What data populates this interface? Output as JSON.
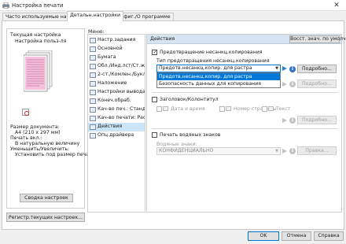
{
  "window": {
    "title": "Настройка печати",
    "close_glyph": "✕"
  },
  "tabs": [
    {
      "label": "Часто используемые настройки",
      "active": false
    },
    {
      "label": "Детальн.настройки",
      "active": true
    },
    {
      "label": "Конфиг./О программе",
      "active": false
    }
  ],
  "left_panel": {
    "heading": "Текущая настройка",
    "setting_name": "Настройка польз-ля",
    "doc_size_label": "Размер документа:",
    "doc_size_value": "A4 (210 x 297 мм)",
    "print_label": "Печать вкл.:",
    "print_value": "В натуральную величину",
    "reduce_label": "Уменьшить/Увеличить:",
    "reduce_value": "Установить под размер печат",
    "summary_button": "Сводка настроек",
    "register_button": "Регистр.текущих настроек..."
  },
  "menu": {
    "label": "Меню:",
    "selected_index": 11,
    "items": [
      "Настр.задания",
      "Основной",
      "Бумага",
      "Обл./Инд.лст/Ст.жрк",
      "2-ст./Комлен./Буклет",
      "Наложение",
      "Настройки вывода",
      "Конеч.обраб.",
      "Кач-во печ.: Станд.",
      "Кач-во печати: Расш.",
      "Действия",
      "Опц.драйвера"
    ]
  },
  "right_panel": {
    "header": "Действия",
    "reset_button": "Восст. знач. по умолч.",
    "copy_protect": {
      "label": "Предотвращение несанкц.копирования",
      "checked": true,
      "type_label": "Тип предотвращения несанкц.копирования",
      "selected": "Предотв.несанкц.копир. для растра",
      "options": [
        "Предотв.несанкц.копир. для растра",
        "Безопасность данных для копирования"
      ],
      "details_button": "Подробно...",
      "details_button_2": "Подробно..."
    },
    "header_footer": {
      "label": "Заголовок/Колонтитул",
      "checked": false,
      "date_time": "Дата и время",
      "page_number": "Номер страницы",
      "text": "Текст",
      "details_button": "Подробно..."
    },
    "watermark": {
      "label": "Печать водяных знаков",
      "checked": false,
      "sub_label": "Водяные знаки:",
      "value": "КОНФИДЕНЦИАЛЬНО",
      "edit_button": "Правка..."
    }
  },
  "footer": {
    "ok": "OK",
    "cancel": "Отмена",
    "help": "Справка"
  },
  "colors": {
    "accent": "#0078d7",
    "selection": "#cce4f7",
    "header_band": "#d7e4f2"
  }
}
